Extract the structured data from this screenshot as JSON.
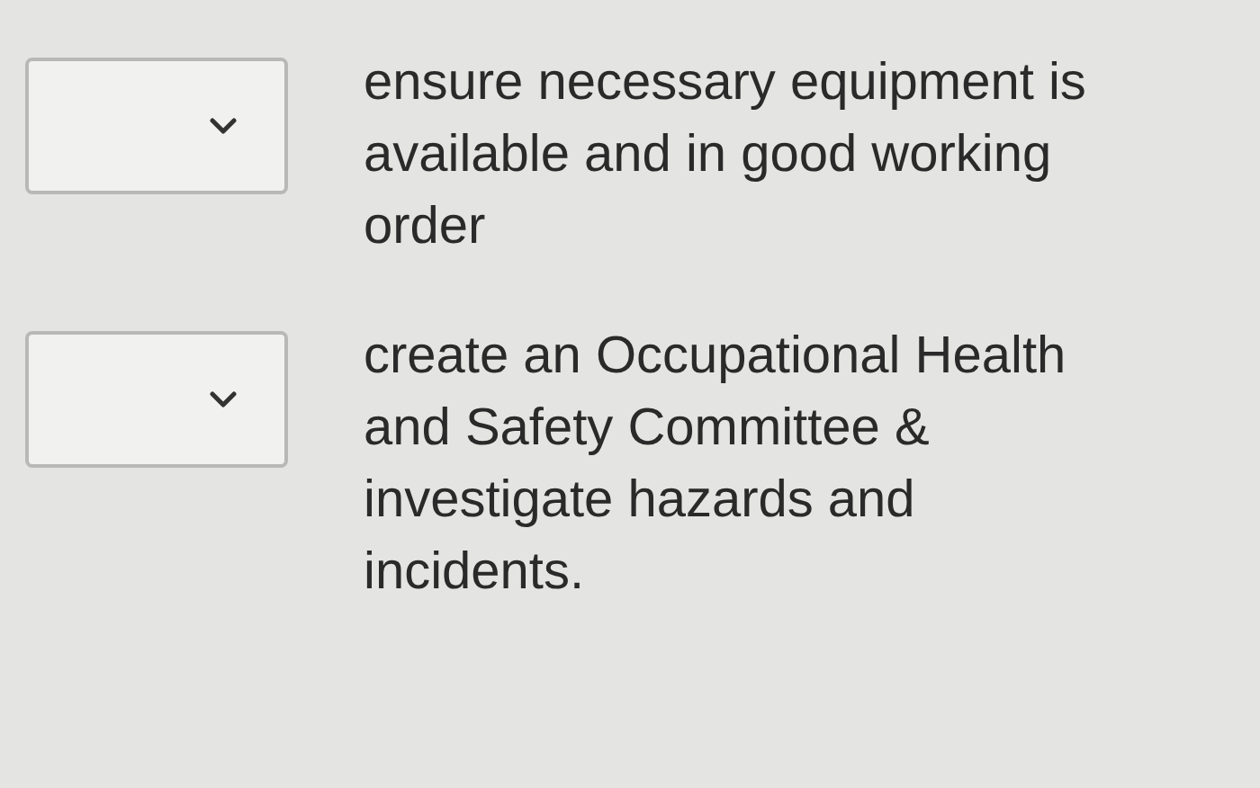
{
  "items": [
    {
      "answer_select": {
        "expanded": false
      },
      "text": "ensure necessary equipment is available and in good working order"
    },
    {
      "answer_select": {
        "expanded": false
      },
      "text": "create an Occupational Health and Safety Committee & investigate hazards and incidents."
    }
  ]
}
